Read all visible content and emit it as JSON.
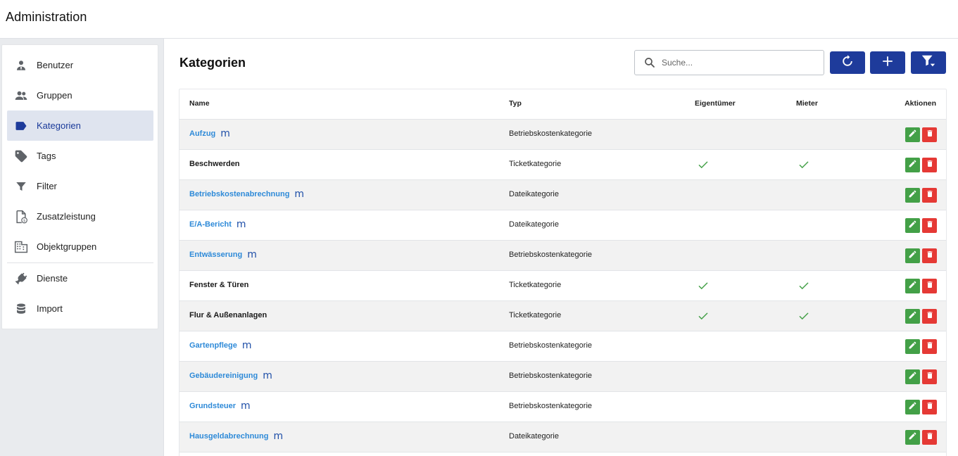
{
  "app": {
    "title": "Administration"
  },
  "sidebar": {
    "items": [
      {
        "label": "Benutzer",
        "icon": "user-icon",
        "active": false
      },
      {
        "label": "Gruppen",
        "icon": "group-icon",
        "active": false
      },
      {
        "label": "Kategorien",
        "icon": "label-icon",
        "active": true
      },
      {
        "label": "Tags",
        "icon": "tag-icon",
        "active": false
      },
      {
        "label": "Filter",
        "icon": "filter-icon",
        "active": false
      },
      {
        "label": "Zusatzleistung",
        "icon": "document-currency-icon",
        "active": false
      },
      {
        "label": "Objektgruppen",
        "icon": "building-icon",
        "active": false
      },
      {
        "label": "Dienste",
        "icon": "plug-icon",
        "active": false
      },
      {
        "label": "Import",
        "icon": "database-icon",
        "active": false
      }
    ]
  },
  "main": {
    "title": "Kategorien",
    "search": {
      "placeholder": "Suche..."
    },
    "toolbar": {
      "refresh_icon": "refresh-icon",
      "add_icon": "plus-icon",
      "filter_icon": "filter-list-icon"
    }
  },
  "table": {
    "headers": {
      "name": "Name",
      "typ": "Typ",
      "eigentuemer": "Eigentümer",
      "mieter": "Mieter",
      "aktionen": "Aktionen"
    },
    "rows": [
      {
        "name": "Aufzug",
        "link": true,
        "m_badge": "m",
        "typ": "Betriebskostenkategorie",
        "eigentuemer": false,
        "mieter": false
      },
      {
        "name": "Beschwerden",
        "link": false,
        "m_badge": "",
        "typ": "Ticketkategorie",
        "eigentuemer": true,
        "mieter": true
      },
      {
        "name": "Betriebskostenabrechnung",
        "link": true,
        "m_badge": "m",
        "typ": "Dateikategorie",
        "eigentuemer": false,
        "mieter": false
      },
      {
        "name": "E/A-Bericht",
        "link": true,
        "m_badge": "m",
        "typ": "Dateikategorie",
        "eigentuemer": false,
        "mieter": false
      },
      {
        "name": "Entwässerung",
        "link": true,
        "m_badge": "m",
        "typ": "Betriebskostenkategorie",
        "eigentuemer": false,
        "mieter": false
      },
      {
        "name": "Fenster & Türen",
        "link": false,
        "m_badge": "",
        "typ": "Ticketkategorie",
        "eigentuemer": true,
        "mieter": true
      },
      {
        "name": "Flur & Außenanlagen",
        "link": false,
        "m_badge": "",
        "typ": "Ticketkategorie",
        "eigentuemer": true,
        "mieter": true
      },
      {
        "name": "Gartenpflege",
        "link": true,
        "m_badge": "m",
        "typ": "Betriebskostenkategorie",
        "eigentuemer": false,
        "mieter": false
      },
      {
        "name": "Gebäudereinigung",
        "link": true,
        "m_badge": "m",
        "typ": "Betriebskostenkategorie",
        "eigentuemer": false,
        "mieter": false
      },
      {
        "name": "Grundsteuer",
        "link": true,
        "m_badge": "m",
        "typ": "Betriebskostenkategorie",
        "eigentuemer": false,
        "mieter": false
      },
      {
        "name": "Hausgeldabrechnung",
        "link": true,
        "m_badge": "m",
        "typ": "Dateikategorie",
        "eigentuemer": false,
        "mieter": false
      }
    ]
  },
  "colors": {
    "primary": "#1e3b9b",
    "link": "#2e8ad8",
    "edit": "#43a047",
    "delete": "#e53935",
    "check": "#43a047",
    "active_nav_bg": "#dfe4ef"
  }
}
